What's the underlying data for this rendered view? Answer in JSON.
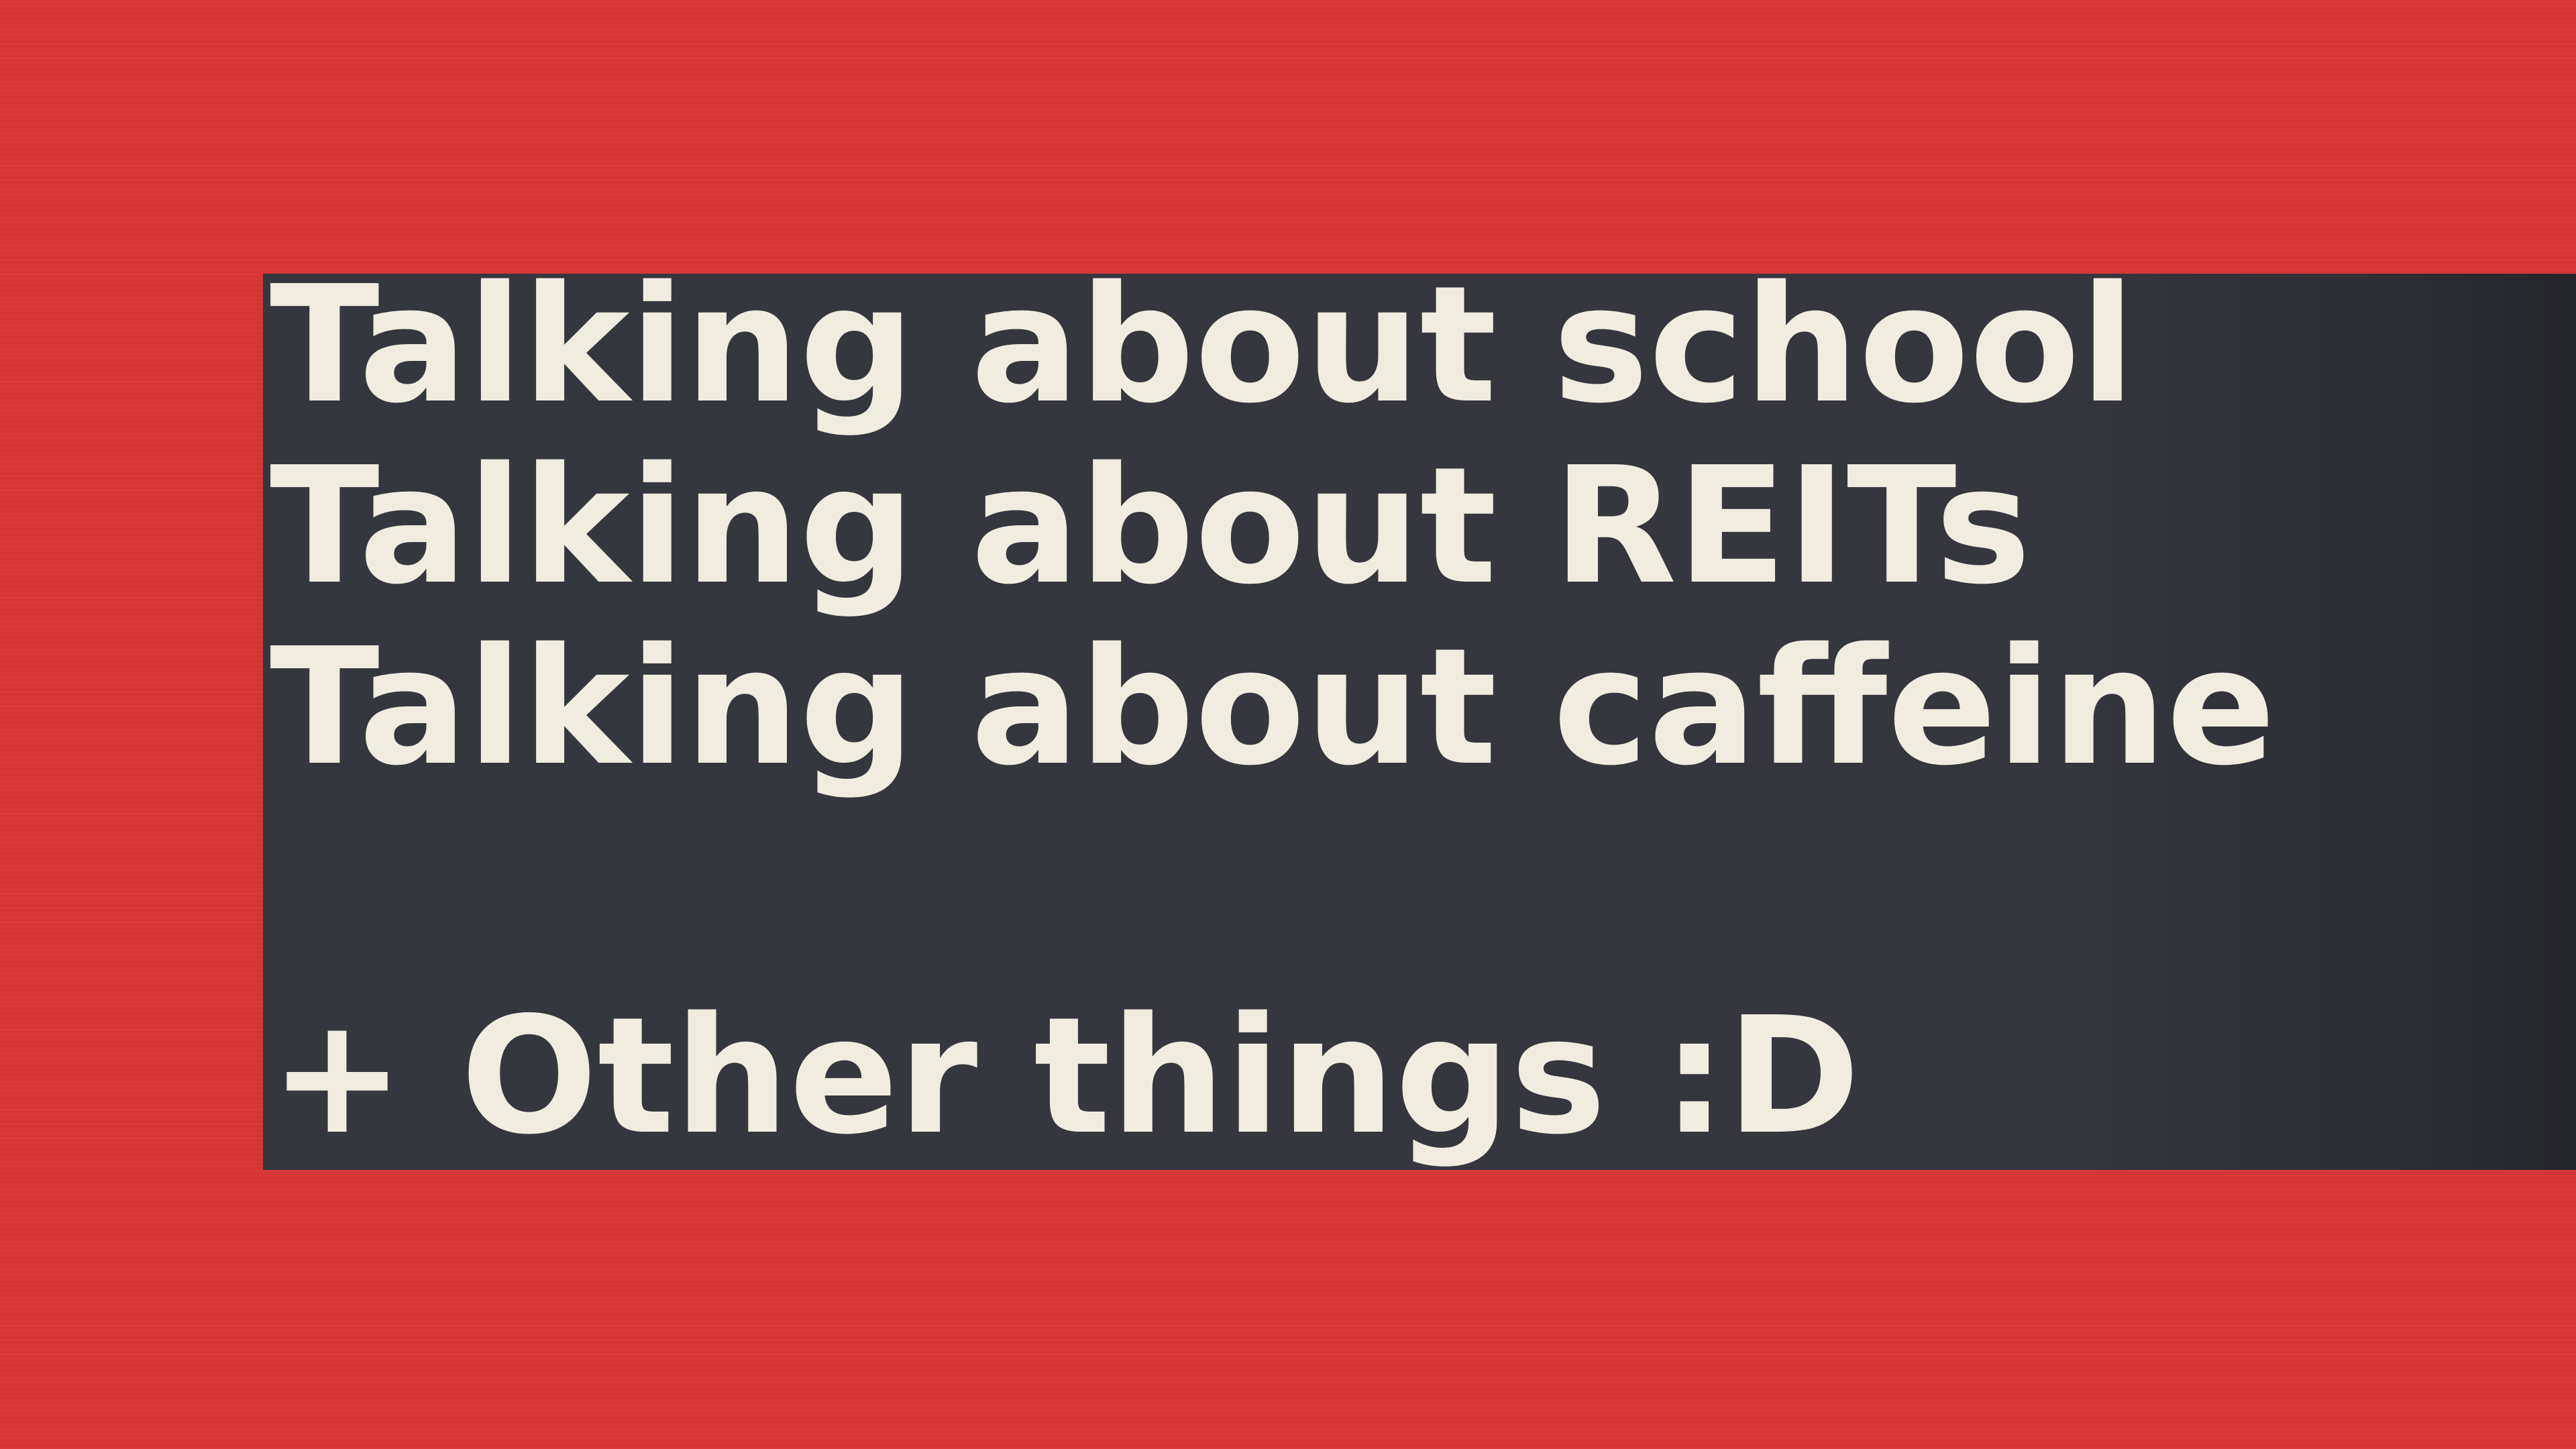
{
  "colors": {
    "background": "#d93636",
    "panel": "#35363e",
    "text": "#f0ede0"
  },
  "panel": {
    "lines": [
      "Talking about school",
      "Talking about REITs",
      "Talking about caffeine"
    ],
    "footer": "+ Other things :D"
  }
}
